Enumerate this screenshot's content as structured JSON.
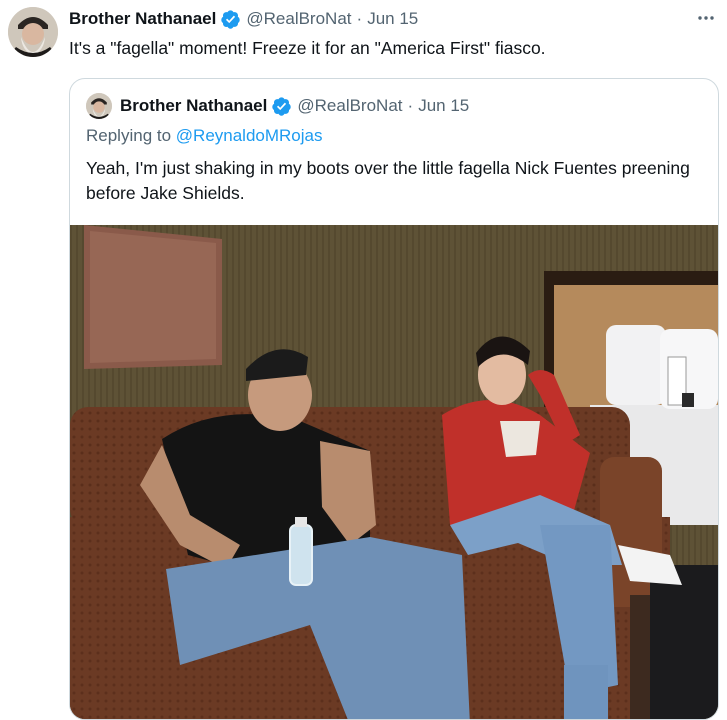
{
  "tweet": {
    "author_name": "Brother Nathanael",
    "handle": "@RealBroNat",
    "separator": "·",
    "date": "Jun 15",
    "text": "It's a \"fagella\" moment! Freeze it for an \"America First\" fiasco.",
    "more_icon": "more-horizontal-icon",
    "verified_icon": "verified-badge-icon"
  },
  "quoted": {
    "author_name": "Brother Nathanael",
    "handle": "@RealBroNat",
    "separator": "·",
    "date": "Jun 15",
    "replying_to_prefix": "Replying to ",
    "replying_to_handle": "@ReynaldoMRojas",
    "text": "Yeah, I'm just shaking in my boots over the little fagella Nick Fuentes preening before Jake Shields."
  },
  "colors": {
    "text_primary": "#0f1419",
    "text_secondary": "#536471",
    "link": "#1d9bf0",
    "verified": "#1d9bf0",
    "border": "#cfd9de"
  }
}
